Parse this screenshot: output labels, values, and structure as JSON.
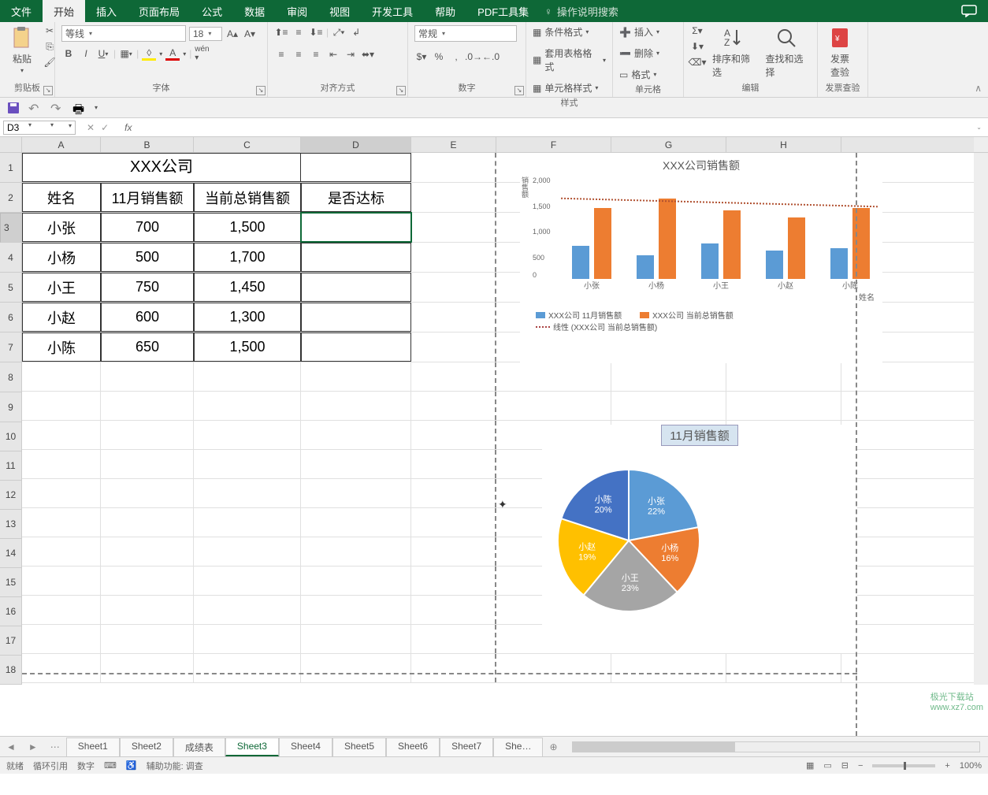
{
  "tabs": {
    "file": "文件",
    "home": "开始",
    "insert": "插入",
    "layout": "页面布局",
    "formula": "公式",
    "data": "数据",
    "review": "审阅",
    "view": "视图",
    "dev": "开发工具",
    "help": "帮助",
    "pdf": "PDF工具集",
    "tellme": "操作说明搜索"
  },
  "groups": {
    "clipboard": "剪贴板",
    "font": "字体",
    "align": "对齐方式",
    "number": "数字",
    "styles": "样式",
    "cells": "单元格",
    "editing": "编辑",
    "invoice": "发票查验"
  },
  "font": {
    "name": "等线",
    "size": "18"
  },
  "number_format": "常规",
  "styles_items": {
    "cond": "条件格式",
    "tbl": "套用表格格式",
    "cell": "单元格样式"
  },
  "cells_items": {
    "ins": "插入",
    "del": "删除",
    "fmt": "格式"
  },
  "edit_items": {
    "sort": "排序和筛选",
    "find": "查找和选择"
  },
  "invoice_btn": "发票\n查验",
  "paste": "粘贴",
  "namebox": "D3",
  "table": {
    "title": "XXX公司",
    "headers": {
      "name": "姓名",
      "nov": "11月销售额",
      "total": "当前总销售额",
      "pass": "是否达标"
    },
    "rows": [
      {
        "name": "小张",
        "nov": "700",
        "total": "1,500"
      },
      {
        "name": "小杨",
        "nov": "500",
        "total": "1,700"
      },
      {
        "name": "小王",
        "nov": "750",
        "total": "1,450"
      },
      {
        "name": "小赵",
        "nov": "600",
        "total": "1,300"
      },
      {
        "name": "小陈",
        "nov": "650",
        "total": "1,500"
      }
    ]
  },
  "columns": [
    "A",
    "B",
    "C",
    "D",
    "E",
    "F",
    "G",
    "H"
  ],
  "row_nums": [
    "1",
    "2",
    "3",
    "4",
    "5",
    "6",
    "7",
    "8",
    "9",
    "10",
    "11",
    "12",
    "13",
    "14",
    "15",
    "16",
    "17",
    "18"
  ],
  "chart_data": [
    {
      "type": "bar",
      "title": "XXX公司销售额",
      "ylabel": "销售额",
      "xlabel": "姓名",
      "categories": [
        "小张",
        "小杨",
        "小王",
        "小赵",
        "小陈"
      ],
      "ylim": [
        0,
        2000
      ],
      "yticks": [
        "0",
        "500",
        "1,000",
        "1,500",
        "2,000"
      ],
      "series": [
        {
          "name": "XXX公司 11月销售额",
          "color": "#5b9bd5",
          "values": [
            700,
            500,
            750,
            600,
            650
          ]
        },
        {
          "name": "XXX公司 当前总销售额",
          "color": "#ed7d31",
          "values": [
            1500,
            1700,
            1450,
            1300,
            1500
          ]
        }
      ],
      "trendline": "线性 (XXX公司 当前总销售额)"
    },
    {
      "type": "pie",
      "title": "11月销售额",
      "slices": [
        {
          "label": "小张",
          "pct": "22%",
          "color": "#5b9bd5"
        },
        {
          "label": "小杨",
          "pct": "16%",
          "color": "#ed7d31"
        },
        {
          "label": "小王",
          "pct": "23%",
          "color": "#a5a5a5"
        },
        {
          "label": "小赵",
          "pct": "19%",
          "color": "#ffc000"
        },
        {
          "label": "小陈",
          "pct": "20%",
          "color": "#4472c4"
        }
      ]
    }
  ],
  "sheets": [
    "Sheet1",
    "Sheet2",
    "成绩表",
    "Sheet3",
    "Sheet4",
    "Sheet5",
    "Sheet6",
    "Sheet7",
    "She…"
  ],
  "active_sheet": "Sheet3",
  "status": {
    "ready": "就绪",
    "circ": "循环引用",
    "num": "数字",
    "a11y": "辅助功能: 调查",
    "zoom": "100%"
  },
  "watermark": {
    "t1": "极光下载站",
    "t2": "www.xz7.com"
  },
  "colors": {
    "blue": "#5b9bd5",
    "orange": "#ed7d31",
    "excel_green": "#0e6837"
  }
}
